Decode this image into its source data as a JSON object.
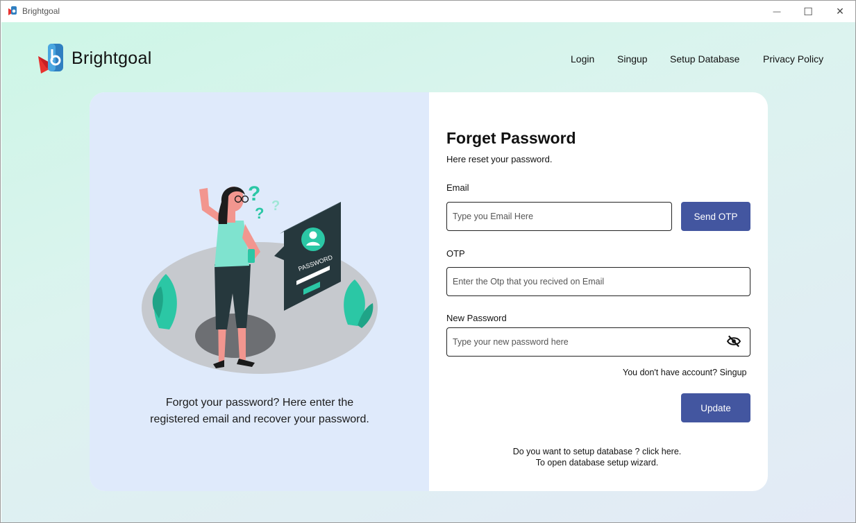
{
  "window": {
    "title": "Brightgoal",
    "minimize_symbol": "—",
    "maximize_symbol": "☐",
    "close_symbol": "✕"
  },
  "header": {
    "brand": "Brightgoal",
    "logo_icon": "brightgoal-logo-icon",
    "nav": {
      "login": "Login",
      "signup": "Singup",
      "setup_database": "Setup Database",
      "privacy_policy": "Privacy Policy"
    }
  },
  "left_panel": {
    "caption": "Forgot your password? Here enter the registered email and recover your password.",
    "illustration_label": "PASSWORD"
  },
  "form": {
    "title": "Forget Password",
    "subtitle": "Here reset your password.",
    "email_label": "Email",
    "email_placeholder": "Type you Email Here",
    "send_otp_label": "Send OTP",
    "otp_label": "OTP",
    "otp_placeholder": "Enter the Otp that you recived on Email",
    "new_password_label": "New Password",
    "new_password_placeholder": "Type your new password here",
    "toggle_visibility_icon": "eye-off-icon",
    "no_account_text": "You don't have account?",
    "signup_link": "Singup",
    "update_label": "Update",
    "db_line_1": "Do you want to setup database ? click here.",
    "db_line_2": "To open database setup wizard."
  },
  "colors": {
    "primary_button": "#4356a0",
    "background_mint": "#cdf6e6",
    "left_panel_bg": "#dfeafb",
    "logo_red": "#e8322f",
    "logo_blue": "#2f7fc1"
  }
}
